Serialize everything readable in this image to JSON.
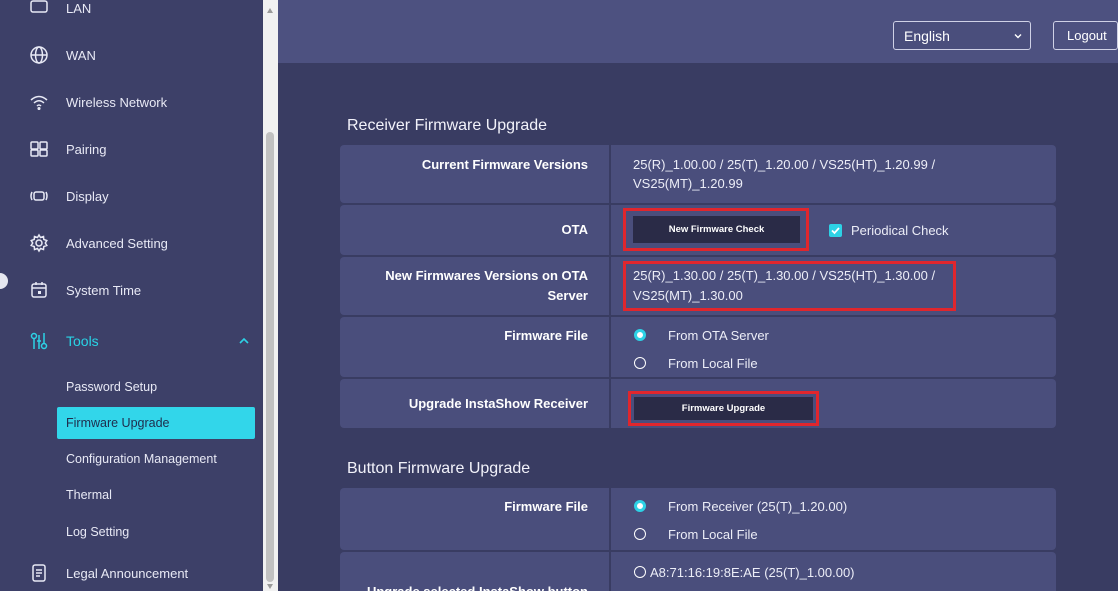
{
  "sidebar": {
    "items": [
      {
        "label": "LAN",
        "icon": "lan-icon"
      },
      {
        "label": "WAN",
        "icon": "globe-icon"
      },
      {
        "label": "Wireless Network",
        "icon": "wifi-icon"
      },
      {
        "label": "Pairing",
        "icon": "pairing-icon"
      },
      {
        "label": "Display",
        "icon": "display-icon"
      },
      {
        "label": "Advanced Setting",
        "icon": "gear-icon"
      },
      {
        "label": "System Time",
        "icon": "calendar-icon"
      },
      {
        "label": "Tools",
        "icon": "tools-icon",
        "expanded": true
      },
      {
        "label": "Legal Announcement",
        "icon": "document-icon"
      }
    ],
    "tools_submenu": [
      {
        "label": "Password Setup"
      },
      {
        "label": "Firmware Upgrade",
        "active": true
      },
      {
        "label": "Configuration Management"
      },
      {
        "label": "Thermal"
      },
      {
        "label": "Log Setting"
      }
    ]
  },
  "header": {
    "language": "English",
    "logout_label": "Logout"
  },
  "receiver": {
    "title": "Receiver Firmware Upgrade",
    "rows": {
      "current_versions": {
        "label": "Current Firmware Versions",
        "value_line1": "25(R)_1.00.00 / 25(T)_1.20.00 / VS25(HT)_1.20.99 /",
        "value_line2": "VS25(MT)_1.20.99"
      },
      "ota": {
        "label": "OTA",
        "button": "New Firmware Check",
        "periodical_check": "Periodical Check",
        "periodical_checked": true
      },
      "new_versions": {
        "label_line1": "New Firmwares Versions on OTA",
        "label_line2": "Server",
        "value_line1": "25(R)_1.30.00 / 25(T)_1.30.00 / VS25(HT)_1.30.00 /",
        "value_line2": "VS25(MT)_1.30.00"
      },
      "firmware_file": {
        "label": "Firmware File",
        "options": [
          "From OTA Server",
          "From Local File"
        ],
        "selected": 0
      },
      "upgrade": {
        "label": "Upgrade InstaShow Receiver",
        "button": "Firmware Upgrade"
      }
    }
  },
  "button_fw": {
    "title": "Button Firmware Upgrade",
    "rows": {
      "firmware_file": {
        "label": "Firmware File",
        "options": [
          "From Receiver (25(T)_1.20.00)",
          "From Local File"
        ],
        "selected": 0
      },
      "upgrade_selected": {
        "label": "Upgrade selected InstaShow button",
        "device": "A8:71:16:19:8E:AE (25(T)_1.00.00)"
      }
    }
  },
  "colors": {
    "accent": "#2dd2e6",
    "highlight_border": "#e0262d",
    "panel": "#4a4e7c",
    "background": "#393c62"
  }
}
